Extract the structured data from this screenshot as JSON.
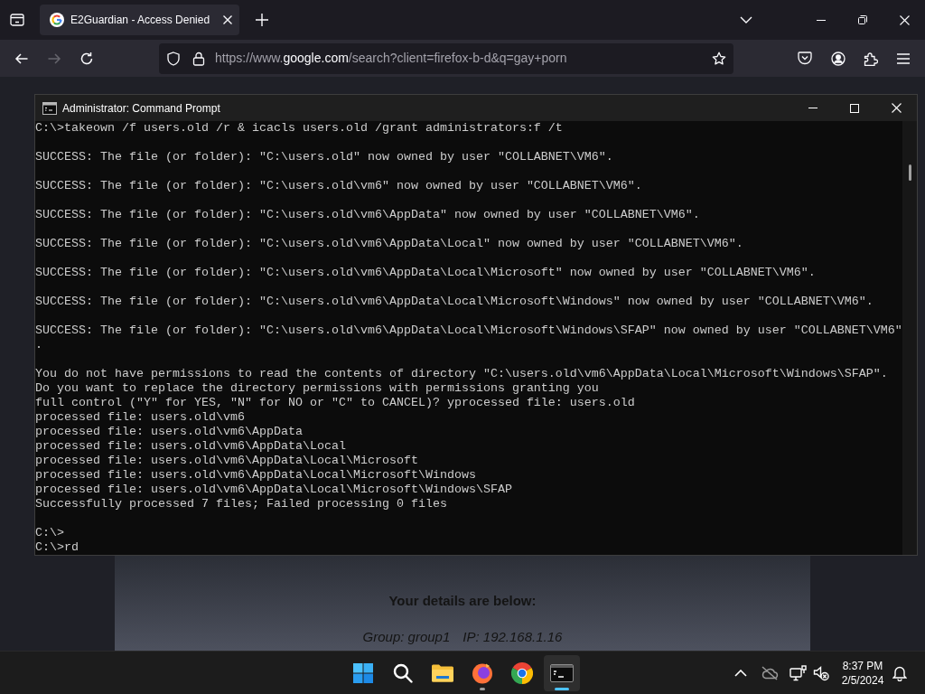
{
  "browser": {
    "tabs": [
      {
        "title": "E2Guardian - Access Denied",
        "selected": true
      }
    ],
    "nav_buttons": [
      {
        "kind": "back",
        "disabled": false
      },
      {
        "kind": "forward",
        "disabled": true
      },
      {
        "kind": "reload",
        "disabled": false
      }
    ],
    "address_bar": {
      "url_prefix": "https://www.",
      "url_domain": "google.com",
      "url_suffix": "/search?client=firefox-b-d&q=gay+porn"
    }
  },
  "console_window": {
    "title": "Administrator: Command Prompt",
    "blocks": [
      [
        "C:\\>takeown /f users.old /r & icacls users.old /grant administrators:f /t"
      ],
      [
        "SUCCESS: The file (or folder): \"C:\\users.old\" now owned by user \"COLLABNET\\VM6\"."
      ],
      [
        "SUCCESS: The file (or folder): \"C:\\users.old\\vm6\" now owned by user \"COLLABNET\\VM6\"."
      ],
      [
        "SUCCESS: The file (or folder): \"C:\\users.old\\vm6\\AppData\" now owned by user \"COLLABNET\\VM6\"."
      ],
      [
        "SUCCESS: The file (or folder): \"C:\\users.old\\vm6\\AppData\\Local\" now owned by user \"COLLABNET\\VM6\"."
      ],
      [
        "SUCCESS: The file (or folder): \"C:\\users.old\\vm6\\AppData\\Local\\Microsoft\" now owned by user \"COLLABNET\\VM6\"."
      ],
      [
        "SUCCESS: The file (or folder): \"C:\\users.old\\vm6\\AppData\\Local\\Microsoft\\Windows\" now owned by user \"COLLABNET\\VM6\"."
      ],
      [
        "SUCCESS: The file (or folder): \"C:\\users.old\\vm6\\AppData\\Local\\Microsoft\\Windows\\SFAP\" now owned by user \"COLLABNET\\VM6\"",
        "."
      ],
      [
        "You do not have permissions to read the contents of directory \"C:\\users.old\\vm6\\AppData\\Local\\Microsoft\\Windows\\SFAP\".",
        "Do you want to replace the directory permissions with permissions granting you",
        "full control (\"Y\" for YES, \"N\" for NO or \"C\" to CANCEL)? yprocessed file: users.old",
        "processed file: users.old\\vm6",
        "processed file: users.old\\vm6\\AppData",
        "processed file: users.old\\vm6\\AppData\\Local",
        "processed file: users.old\\vm6\\AppData\\Local\\Microsoft",
        "processed file: users.old\\vm6\\AppData\\Local\\Microsoft\\Windows",
        "processed file: users.old\\vm6\\AppData\\Local\\Microsoft\\Windows\\SFAP",
        "Successfully processed 7 files; Failed processing 0 files"
      ],
      [
        "C:\\>",
        "C:\\>rd"
      ]
    ]
  },
  "page": {
    "heading": "Your details are below:",
    "details": [
      "Group: group1",
      "IP: 192.168.1.16"
    ]
  },
  "taskbar": {
    "apps": [
      {
        "kind": "explorer",
        "running": false,
        "active": false
      },
      {
        "kind": "firefox",
        "running": true,
        "active": false
      },
      {
        "kind": "chrome",
        "running": false,
        "active": false
      },
      {
        "kind": "terminal",
        "running": true,
        "active": true
      }
    ],
    "clock": {
      "time": "8:37 PM",
      "date": "2/5/2024"
    }
  }
}
